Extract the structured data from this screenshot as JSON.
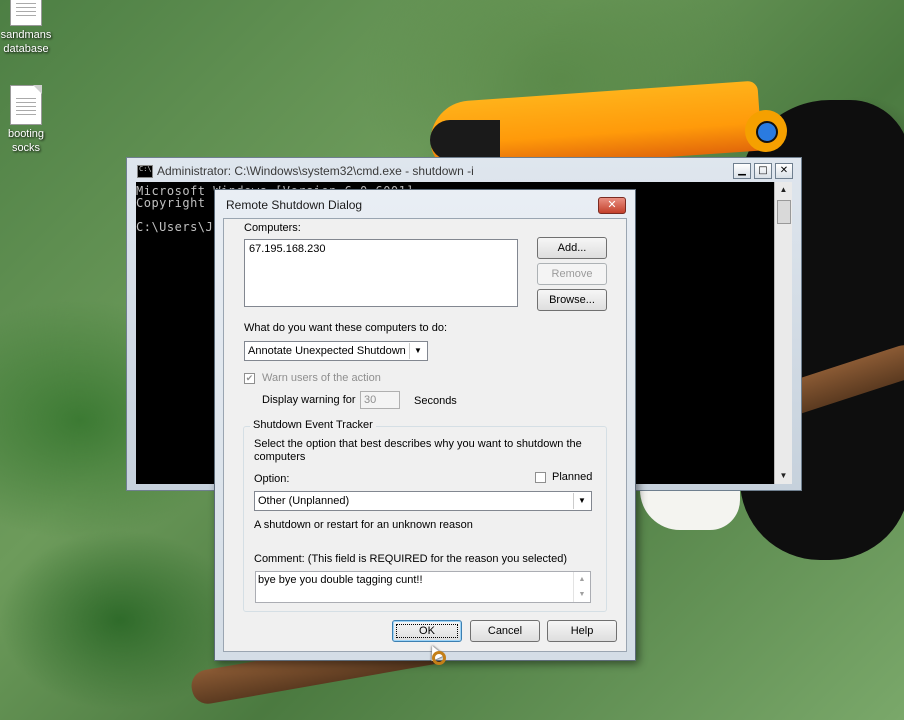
{
  "desktop": {
    "icons": [
      {
        "label_line1": "sandmans",
        "label_line2": "database",
        "icon": "file-icon"
      },
      {
        "label_line1": "booting",
        "label_line2": "socks",
        "icon": "file-icon"
      }
    ]
  },
  "cmd_window": {
    "title": "Administrator: C:\\Windows\\system32\\cmd.exe - shutdown  -i",
    "icon": "cmd-icon",
    "minimize": "▁",
    "maximize": "□",
    "close": "✕",
    "lines": [
      "Microsoft Windows [Version 6.0.6001]",
      "Copyright",
      "",
      "C:\\Users\\J"
    ],
    "scroll_up": "▲",
    "scroll_down": "▼"
  },
  "dialog": {
    "title": "Remote Shutdown Dialog",
    "close": "✕",
    "computers_label": "Computers:",
    "computers": [
      "67.195.168.230"
    ],
    "add_button": "Add...",
    "remove_button": "Remove",
    "browse_button": "Browse...",
    "action_label": "What do you want these computers to do:",
    "action_value": "Annotate Unexpected Shutdown",
    "warn_label": "Warn users of the action",
    "warn_checked": true,
    "display_warning_label": "Display warning for",
    "display_warning_value": "30",
    "seconds_label": "Seconds",
    "tracker": {
      "title": "Shutdown Event Tracker",
      "description": "Select the option that best describes why you want to shutdown the computers",
      "option_label": "Option:",
      "planned_label": "Planned",
      "planned_checked": false,
      "option_value": "Other (Unplanned)",
      "reason_text": "A shutdown or restart for an unknown reason",
      "comment_label": "Comment: (This field is REQUIRED for the reason you selected)",
      "comment_value": "bye bye you double tagging cunt!!"
    },
    "ok_button": "OK",
    "cancel_button": "Cancel",
    "help_button": "Help",
    "dropdown_arrow": "▼",
    "check_mark": "✔"
  }
}
